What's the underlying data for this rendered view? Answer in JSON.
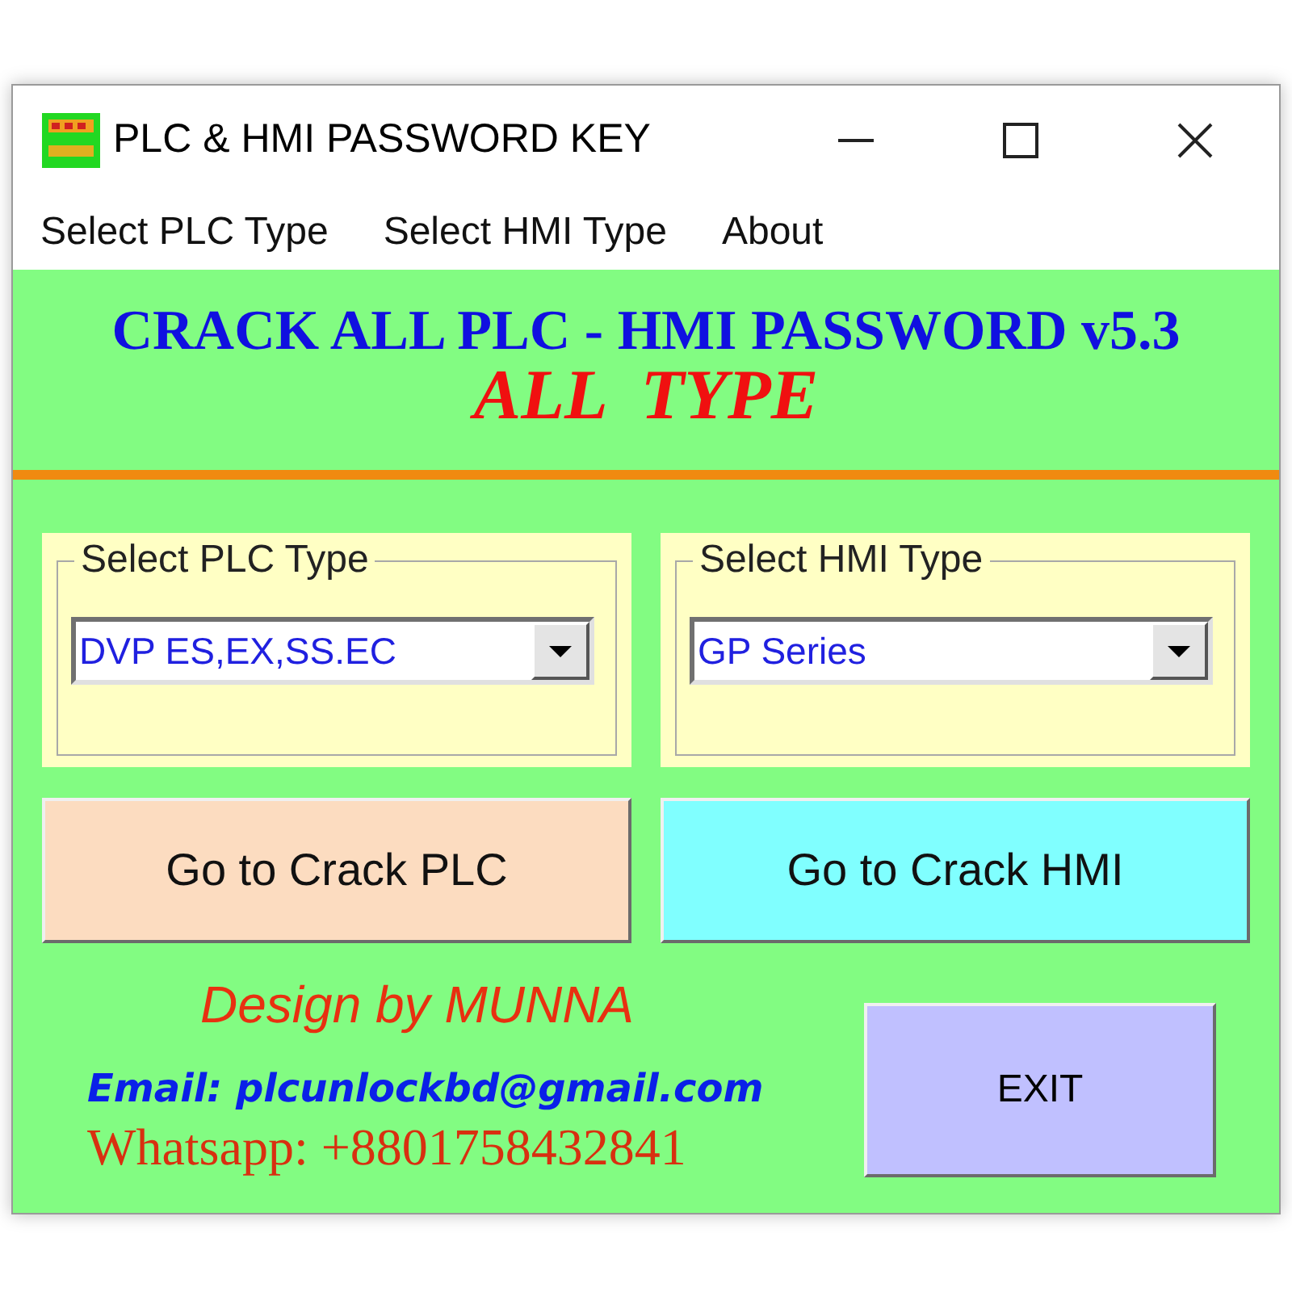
{
  "window": {
    "title": "PLC & HMI PASSWORD KEY"
  },
  "menu": [
    {
      "label": "Select PLC Type"
    },
    {
      "label": "Select HMI Type"
    },
    {
      "label": "About"
    }
  ],
  "header": {
    "title": "CRACK ALL PLC - HMI PASSWORD v5.3",
    "subtitle": "ALL  TYPE"
  },
  "groups": [
    {
      "label": "Select PLC Type",
      "value": "DVP ES,EX,SS.EC"
    },
    {
      "label": "Select HMI Type",
      "value": "GP Series"
    }
  ],
  "buttons": [
    {
      "label": "Go to Crack PLC",
      "color": "#fcdcc0"
    },
    {
      "label": "Go to Crack HMI",
      "color": "#80ffff"
    }
  ],
  "credits": {
    "designer": "Design by MUNNA",
    "email": "Email: plcunlockbd@gmail.com",
    "whatsapp": "Whatsapp: +8801758432841"
  },
  "exit_button": {
    "label": "EXIT"
  }
}
